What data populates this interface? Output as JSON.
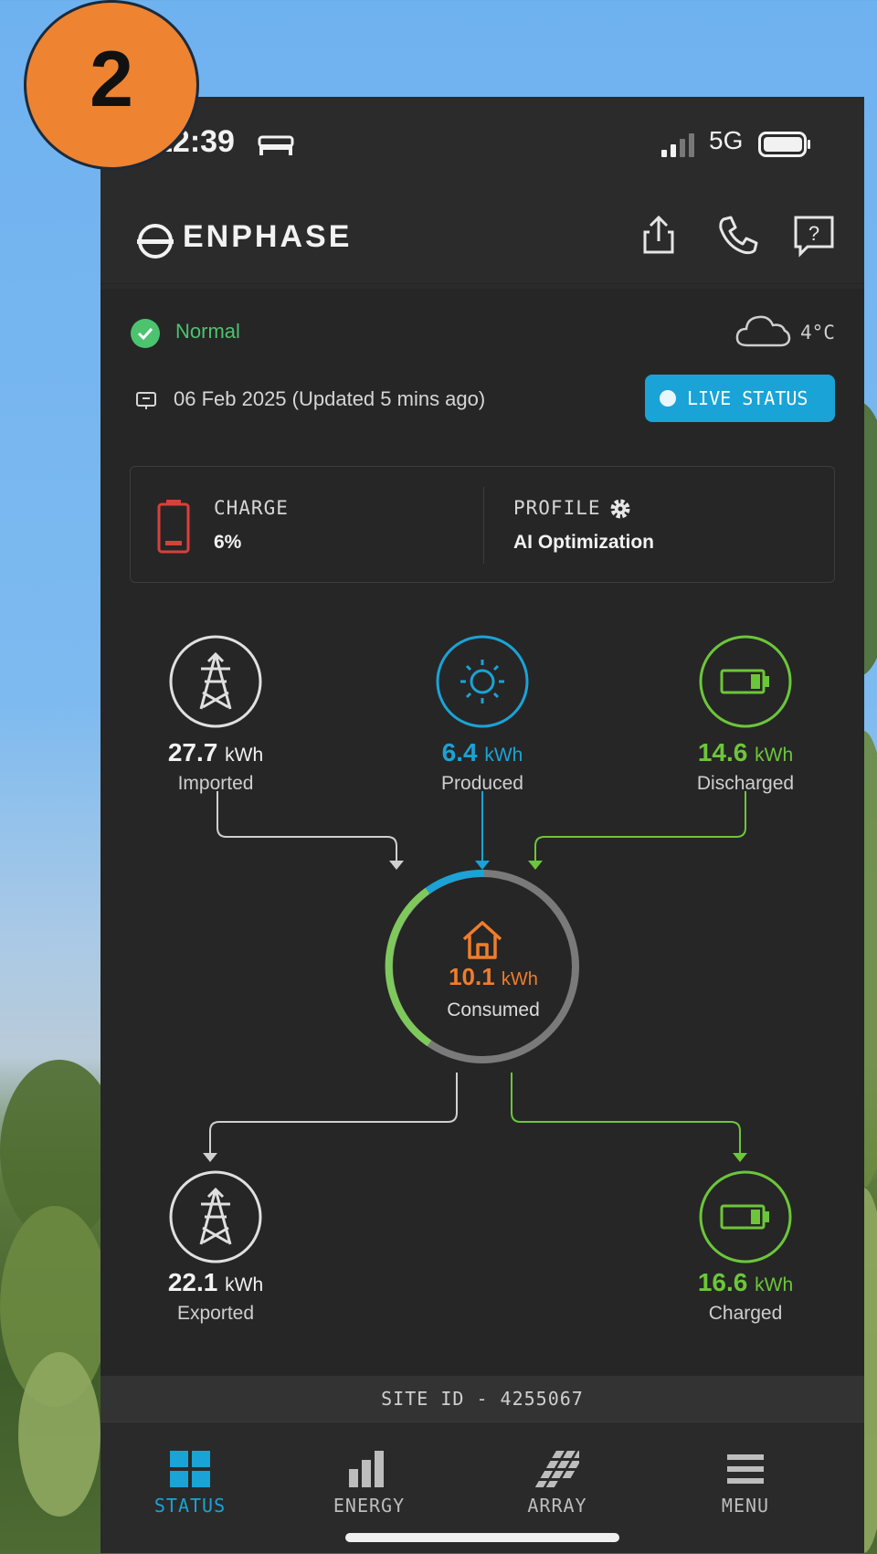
{
  "badge": "2",
  "statusbar": {
    "time": "12:39",
    "network": "5G"
  },
  "header": {
    "brand": "ENPHASE"
  },
  "status": {
    "state": "Normal",
    "temperature": "4°C",
    "date": "06 Feb 2025 (Updated 5 mins ago)",
    "live_label": "LIVE STATUS"
  },
  "summary": {
    "charge_label": "CHARGE",
    "charge_value": "6%",
    "profile_label": "PROFILE",
    "profile_value": "AI Optimization"
  },
  "flows": {
    "imported": {
      "value": "27.7",
      "unit": "kWh",
      "label": "Imported"
    },
    "produced": {
      "value": "6.4",
      "unit": "kWh",
      "label": "Produced"
    },
    "discharged": {
      "value": "14.6",
      "unit": "kWh",
      "label": "Discharged"
    },
    "consumed": {
      "value": "10.1",
      "unit": "kWh",
      "label": "Consumed"
    },
    "exported": {
      "value": "22.1",
      "unit": "kWh",
      "label": "Exported"
    },
    "charged": {
      "value": "16.6",
      "unit": "kWh",
      "label": "Charged"
    }
  },
  "site": {
    "label": "SITE ID - 4255067"
  },
  "tabs": [
    {
      "label": "STATUS",
      "icon": "grid-icon"
    },
    {
      "label": "ENERGY",
      "icon": "bar-chart-icon"
    },
    {
      "label": "ARRAY",
      "icon": "solar-array-icon"
    },
    {
      "label": "MENU",
      "icon": "hamburger-menu-icon"
    }
  ],
  "colors": {
    "accent_blue": "#1aa3d6",
    "battery_green": "#6cc63a",
    "grid_white": "#e0e0e0",
    "house_orange": "#f07d2a",
    "alert_red": "#d9403a",
    "normal_green": "#4cc36f",
    "active_tab": "#1aa3d6"
  }
}
